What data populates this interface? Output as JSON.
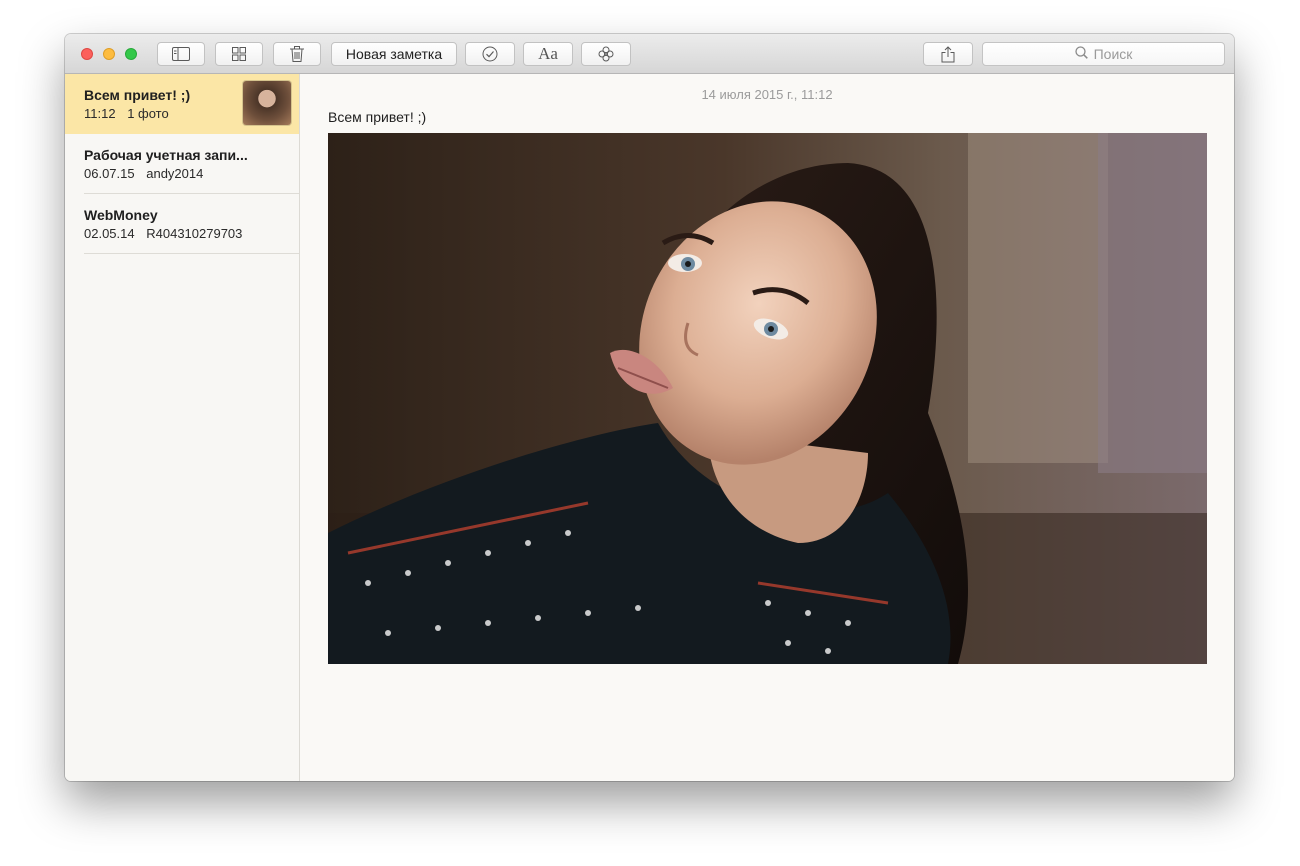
{
  "toolbar": {
    "new_note_label": "Новая заметка",
    "format_label": "Aa",
    "search_placeholder": "Поиск",
    "icons": [
      "sidebar-toggle-icon",
      "grid-view-icon",
      "trash-icon",
      "checkmark-circle-icon",
      "text-format-icon",
      "attachment-flower-icon",
      "share-icon",
      "search-icon"
    ]
  },
  "notes": [
    {
      "title": "Всем привет! ;)",
      "time": "11:12",
      "meta": "1 фото",
      "selected": true
    },
    {
      "title": "Рабочая учетная запи...",
      "time": "06.07.15",
      "meta": "andy2014"
    },
    {
      "title": "WebMoney",
      "time": "02.05.14",
      "meta": "R404310279703"
    }
  ],
  "editor": {
    "date": "14 июля 2015 г., 11:12",
    "text": "Всем привет! ;)"
  },
  "colors": {
    "selected_note": "#fbe6a6",
    "close": "#fc605c",
    "minimize": "#fdbc40",
    "zoom": "#34c84a"
  }
}
